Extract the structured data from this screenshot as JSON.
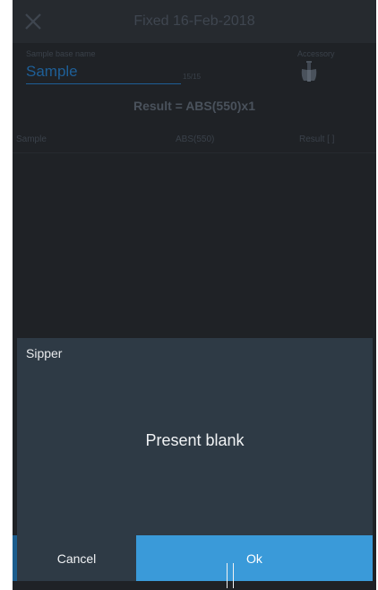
{
  "header": {
    "title": "Fixed 16-Feb-2018"
  },
  "sample": {
    "label": "Sample base name",
    "value": "Sample",
    "counter": "15/15"
  },
  "accessory": {
    "label": "Accessory",
    "icon": "sipper-icon"
  },
  "result_formula": "Result = ABS(550)x1",
  "table": {
    "columns": [
      "Sample",
      "ABS(550)",
      "Result [ ]"
    ],
    "rows": []
  },
  "dialog": {
    "title": "Sipper",
    "message": "Present blank",
    "cancel_label": "Cancel",
    "ok_label": "Ok"
  },
  "colors": {
    "accent": "#3a9ad9",
    "dialog_bg": "#2e3a45",
    "screen_bg": "#1f2226"
  }
}
